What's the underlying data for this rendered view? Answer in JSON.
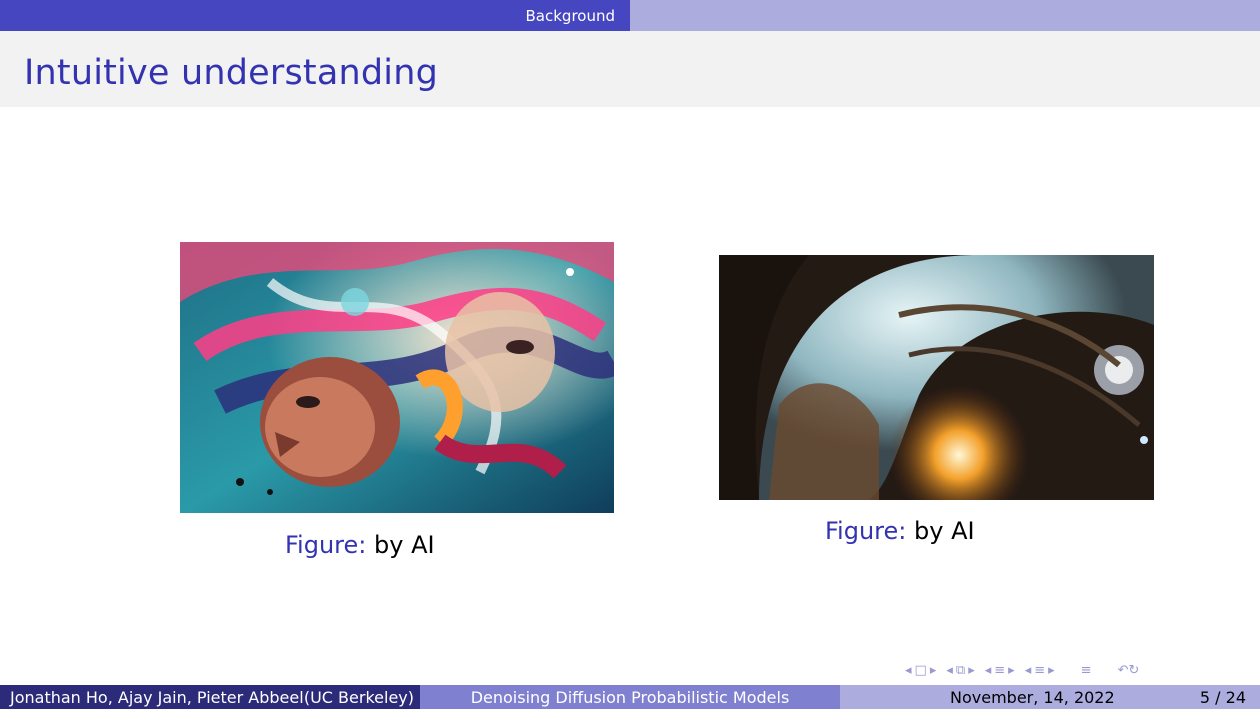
{
  "header": {
    "section": "Background"
  },
  "slide": {
    "title": "Intuitive understanding"
  },
  "figures": [
    {
      "caption_label": "Figure:",
      "caption_text": " by AI"
    },
    {
      "caption_label": "Figure:",
      "caption_text": " by AI"
    }
  ],
  "footer": {
    "authors": "Jonathan Ho, Ajay Jain, Pieter Abbeel",
    "affiliation": "(UC Berkeley)",
    "title": "Denoising Diffusion Probabilistic Models",
    "date": "November, 14, 2022",
    "page": "5 / 24"
  },
  "nav_icons": [
    "frame-prev-icon",
    "frame-icon",
    "frame-next-icon",
    "subsection-prev-icon",
    "subsection-icon",
    "subsection-next-icon",
    "section-prev-icon",
    "section-icon",
    "section-next-icon",
    "align-icon",
    "undo-search-icon"
  ],
  "colors": {
    "accent": "#3333b2",
    "header_dark": "#4646c0",
    "header_light": "#acacdf",
    "footer_dark": "#2b2b7a",
    "footer_mid": "#8080d0"
  }
}
